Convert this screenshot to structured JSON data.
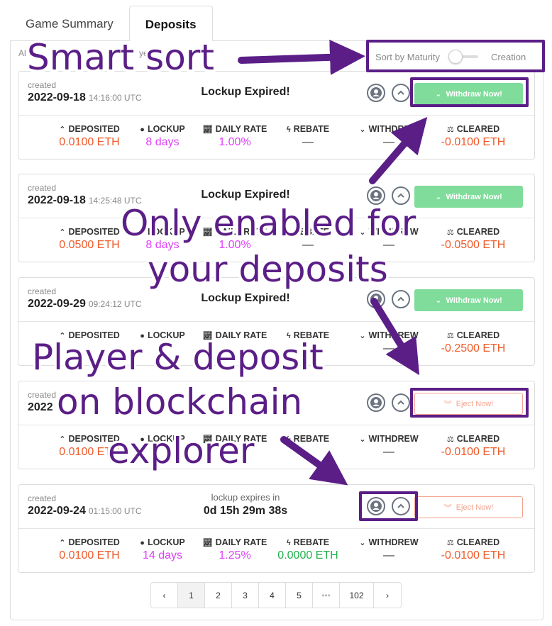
{
  "tabs": [
    {
      "label": "Game Summary",
      "active": false
    },
    {
      "label": "Deposits",
      "active": true
    }
  ],
  "filters": {
    "partial_1": "Al",
    "partial_2": "ye"
  },
  "sort": {
    "left_label": "Sort by Maturity",
    "right_label": "Creation"
  },
  "created_label": "created",
  "headers": {
    "deposited": "DEPOSITED",
    "lockup": "LOCKUP",
    "daily_rate": "DAILY RATE",
    "rebate": "REBATE",
    "withdrew": "WITHDREW",
    "cleared": "CLEARED"
  },
  "deposits": [
    {
      "date": "2022-09-18",
      "time": "14:16:00 UTC",
      "status": "Lockup Expired!",
      "action": "Withdraw Now!",
      "deposited": "0.0100 ETH",
      "lockup": "8 days",
      "daily_rate": "1.00%",
      "rebate": "—",
      "withdrew": "—",
      "cleared": "-0.0100 ETH"
    },
    {
      "date": "2022-09-18",
      "time": "14:25:48 UTC",
      "status": "Lockup Expired!",
      "action": "Withdraw Now!",
      "deposited": "0.0500 ETH",
      "lockup": "8 days",
      "daily_rate": "1.00%",
      "rebate": "—",
      "withdrew": "—",
      "cleared": "-0.0500 ETH"
    },
    {
      "date": "2022-09-29",
      "time": "09:24:12 UTC",
      "status": "Lockup Expired!",
      "action": "Withdraw Now!",
      "deposited": "",
      "lockup": "",
      "daily_rate": "",
      "rebate": "—",
      "withdrew": "—",
      "cleared": "-0.2500 ETH"
    },
    {
      "date": "2022",
      "time": "",
      "status": "",
      "action": "Eject Now!",
      "deposited": "0.0100 ETH",
      "lockup": "",
      "daily_rate": "",
      "rebate": "",
      "withdrew": "—",
      "cleared": "-0.0100 ETH"
    },
    {
      "date": "2022-09-24",
      "time": "01:15:00 UTC",
      "status_sub": "lockup expires in",
      "countdown": "0d 15h 29m 38s",
      "action": "Eject Now!",
      "deposited": "0.0100 ETH",
      "lockup": "14 days",
      "daily_rate": "1.25%",
      "rebate": "0.0000 ETH",
      "withdrew": "—",
      "cleared": "-0.0100 ETH"
    }
  ],
  "pagination": [
    "‹",
    "1",
    "2",
    "3",
    "4",
    "5",
    "•••",
    "102",
    "›"
  ],
  "annotations": {
    "smart_sort": "Smart sort",
    "only_enabled_1": "Only enabled for",
    "only_enabled_2": "your deposits",
    "player_1": "Player & deposit",
    "player_2": "on blockchain",
    "player_3": "explorer"
  },
  "colors": {
    "annotation": "#5b1e87",
    "withdraw": "#7fdc9a",
    "eject": "#f4a48f",
    "eth_orange": "#f05a28",
    "magenta": "#e040fb",
    "green": "#21b14b"
  }
}
